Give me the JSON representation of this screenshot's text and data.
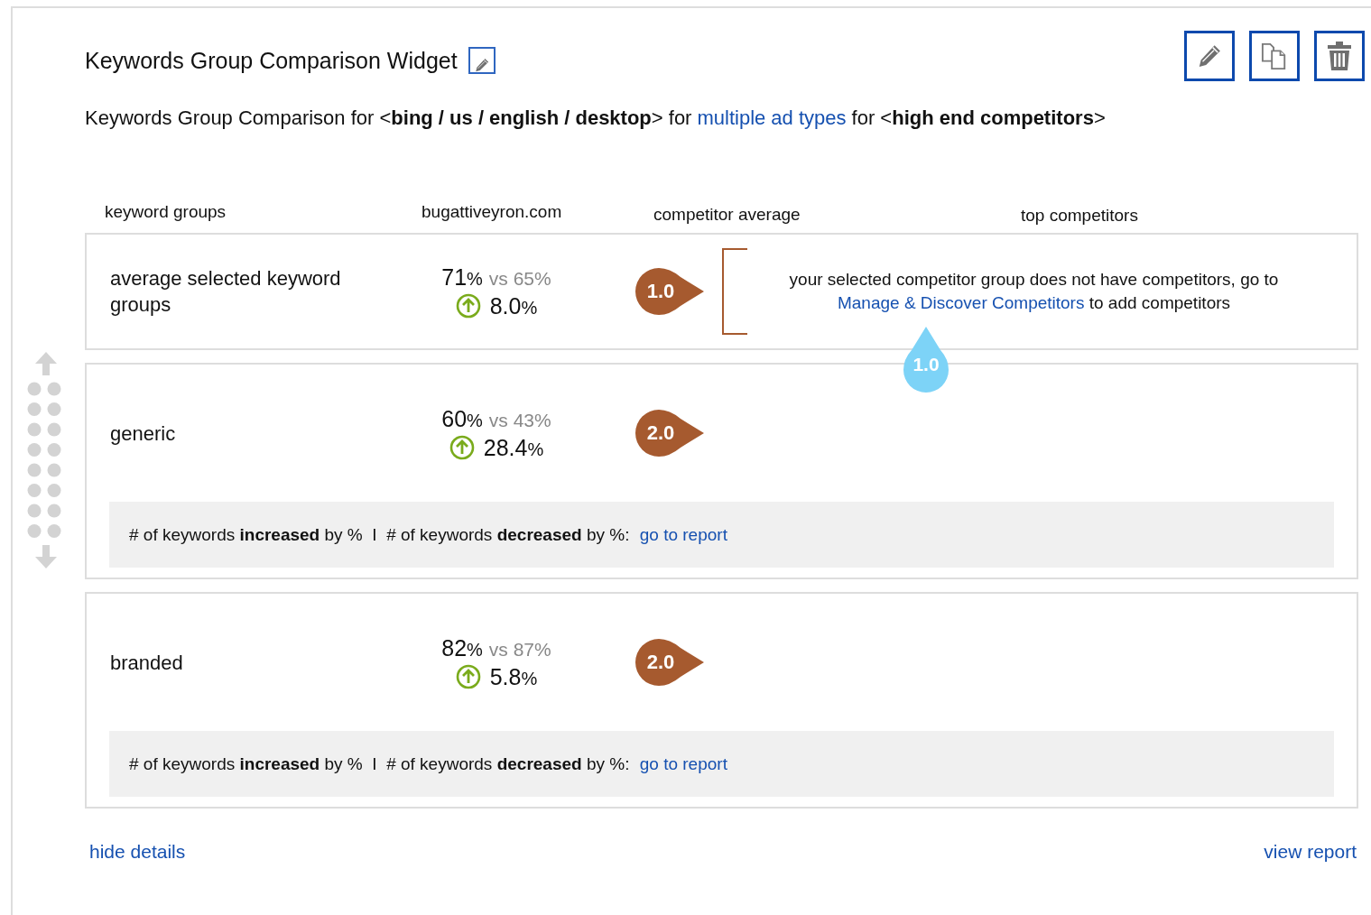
{
  "widget": {
    "title": "Keywords Group Comparison Widget",
    "subtitle": [
      {
        "kind": "text",
        "text": "Keywords Group Comparison for <**bing / us / english / desktop**> for"
      },
      {
        "kind": "link",
        "text": "multiple ad types"
      },
      {
        "kind": "text",
        "text": "for <**high end competitors**>"
      }
    ]
  },
  "columns": [
    "keyword groups",
    "bugattiveyron.com",
    "competitor average",
    "top competitors"
  ],
  "rows": [
    {
      "name": "average selected keyword groups",
      "value": "71",
      "unit": "%",
      "vs": "vs 65",
      "vs_unit": "%",
      "change": "8.0",
      "change_unit": "%",
      "increased": true,
      "score": "1.0",
      "competitors": {
        "message": "your selected competitor group does not have competitors, go to",
        "link": "Manage & Discover Competitors",
        "after": "to add competitors",
        "marker": "1.0"
      }
    },
    {
      "name": "generic",
      "value": "60",
      "unit": "%",
      "vs": "vs 43",
      "vs_unit": "%",
      "change": "28.4",
      "change_unit": "%",
      "increased": true,
      "score": "2.0",
      "details": {
        "text": "# of keywords **increased** by %  I  # of keywords **decreased** by %:",
        "link": "go to report"
      }
    },
    {
      "name": "branded",
      "value": "82",
      "unit": "%",
      "vs": "vs 87",
      "vs_unit": "%",
      "change": "5.8",
      "change_unit": "%",
      "increased": true,
      "score": "2.0",
      "details": {
        "text": "# of keywords **increased** by %  I  # of keywords **decreased** by %:",
        "link": "go to report"
      }
    }
  ],
  "footer": {
    "left_link": "hide details",
    "right_link": "view report"
  }
}
